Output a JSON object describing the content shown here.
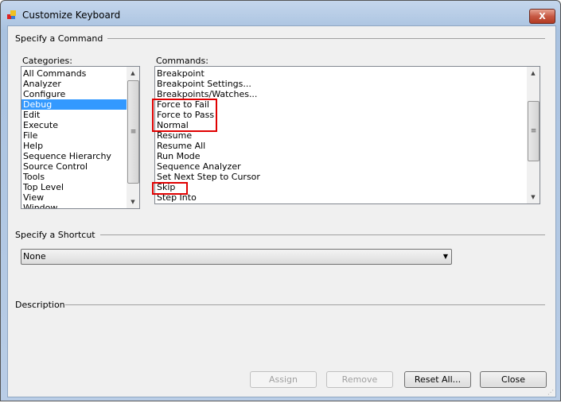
{
  "window": {
    "title": "Customize Keyboard",
    "close_label": "X"
  },
  "command_group": {
    "label": "Specify a Command",
    "categories_label": "Categories:",
    "commands_label": "Commands:"
  },
  "categories": [
    "All Commands",
    "Analyzer",
    "Configure",
    "Debug",
    "Edit",
    "Execute",
    "File",
    "Help",
    "Sequence Hierarchy",
    "Source Control",
    "Tools",
    "Top Level",
    "View",
    "Window"
  ],
  "selected_category": "Debug",
  "commands": [
    "Breakpoint",
    "Breakpoint Settings...",
    "Breakpoints/Watches...",
    "Force to Fail",
    "Force to Pass",
    "Normal",
    "Resume",
    "Resume All",
    "Run Mode",
    "Sequence Analyzer",
    "Set Next Step to Cursor",
    "Skip",
    "Step Into"
  ],
  "highlighted_commands": [
    "Force to Fail",
    "Force to Pass",
    "Normal",
    "Skip"
  ],
  "highlight_color": "#e00000",
  "shortcut_group": {
    "label": "Specify a Shortcut",
    "value": "None"
  },
  "description_group": {
    "label": "Description"
  },
  "buttons": {
    "assign": "Assign",
    "remove": "Remove",
    "reset_all": "Reset All...",
    "close": "Close"
  }
}
